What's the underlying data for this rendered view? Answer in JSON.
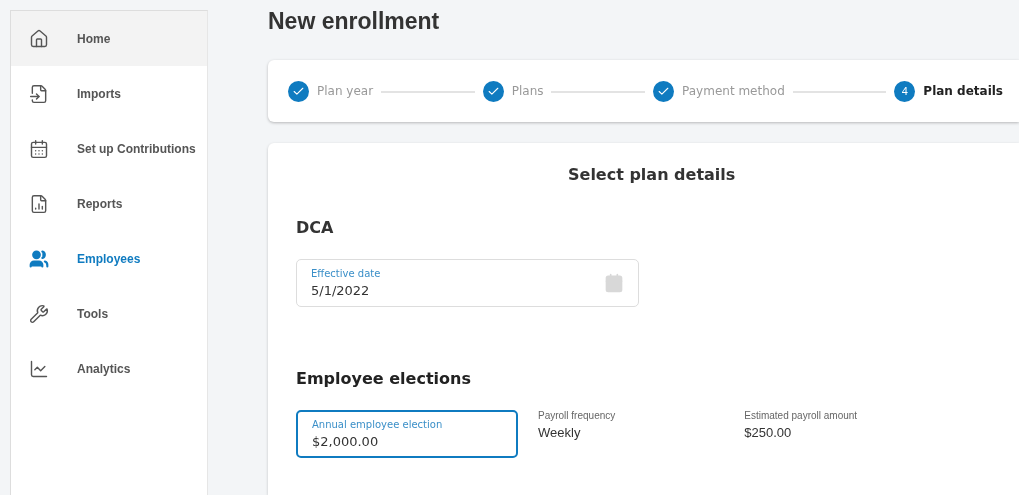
{
  "sidebar": {
    "items": [
      {
        "label": "Home",
        "highlighted": true,
        "selected": false
      },
      {
        "label": "Imports",
        "highlighted": false,
        "selected": false
      },
      {
        "label": "Set up Contributions",
        "highlighted": false,
        "selected": false
      },
      {
        "label": "Reports",
        "highlighted": false,
        "selected": false
      },
      {
        "label": "Employees",
        "highlighted": false,
        "selected": true
      },
      {
        "label": "Tools",
        "highlighted": false,
        "selected": false
      },
      {
        "label": "Analytics",
        "highlighted": false,
        "selected": false
      }
    ]
  },
  "page": {
    "title": "New enrollment"
  },
  "stepper": {
    "steps": [
      {
        "label": "Plan year",
        "completed": true,
        "selected": false
      },
      {
        "label": "Plans",
        "completed": true,
        "selected": false
      },
      {
        "label": "Payment method",
        "completed": true,
        "selected": false
      },
      {
        "number": "4",
        "label": "Plan details",
        "completed": false,
        "selected": true
      }
    ]
  },
  "card": {
    "title": "Select plan details",
    "plan": "DCA",
    "effective_date": {
      "label": "Effective date",
      "value": "5/1/2022",
      "focused": false
    },
    "section": "Employee elections",
    "election": {
      "label": "Annual employee election",
      "value": "$2,000.00",
      "focused": true
    },
    "info": [
      {
        "label": "Payroll frequency",
        "value": "Weekly"
      },
      {
        "label": "Estimated payroll amount",
        "value": "$250.00"
      }
    ]
  }
}
